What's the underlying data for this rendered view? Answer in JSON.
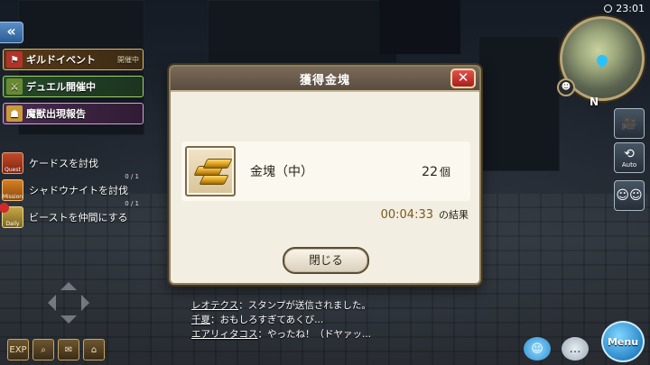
{
  "status_bar": {
    "time": "23:01"
  },
  "banners": [
    {
      "label": "ギルドイベント",
      "tag": "開催中",
      "icon": "guild-event-icon"
    },
    {
      "label": "デュエル開催中",
      "tag": "",
      "icon": "duel-icon"
    },
    {
      "label": "魔獣出現報告",
      "tag": "",
      "icon": "beast-report-icon"
    }
  ],
  "quests": [
    {
      "category": "Quest",
      "label": "ケードスを討伐",
      "count": "0 / 1"
    },
    {
      "category": "Mission",
      "label": "シャドウナイトを討伐",
      "count": "0 / 1"
    },
    {
      "category": "Daily",
      "label": "ビーストを仲間にする",
      "count": "",
      "badge": ""
    }
  ],
  "chat": [
    {
      "name": "レオテクス",
      "message": "：スタンプが送信されました。"
    },
    {
      "name": "千夏",
      "message": "：おもしろすぎてあくび..."
    },
    {
      "name": "エアリィタコス",
      "message": "：やったね！（ドヤァッ..."
    }
  ],
  "bottom_icons": [
    "EXP",
    "",
    "",
    ""
  ],
  "minimap": {
    "north_label": "N"
  },
  "right_buttons": [
    {
      "label": "",
      "icon": "camera-icon"
    },
    {
      "label": "Auto",
      "icon": "auto-icon"
    },
    {
      "label": "",
      "icon": "party-icon"
    }
  ],
  "menu_label": "Menu",
  "dialog": {
    "title": "獲得金塊",
    "close_symbol": "✕",
    "item": {
      "name": "金塊（中）",
      "quantity": "22",
      "unit": "個",
      "icon": "gold-bars-icon"
    },
    "elapsed_time": "00:04:33",
    "time_suffix": "の結果",
    "close_button_label": "閉じる"
  },
  "colors": {
    "dialog_bg": "#f3eee2",
    "header": "#6a5b4d",
    "close_red": "#c3322d",
    "time_gold": "#7a5a1a"
  }
}
